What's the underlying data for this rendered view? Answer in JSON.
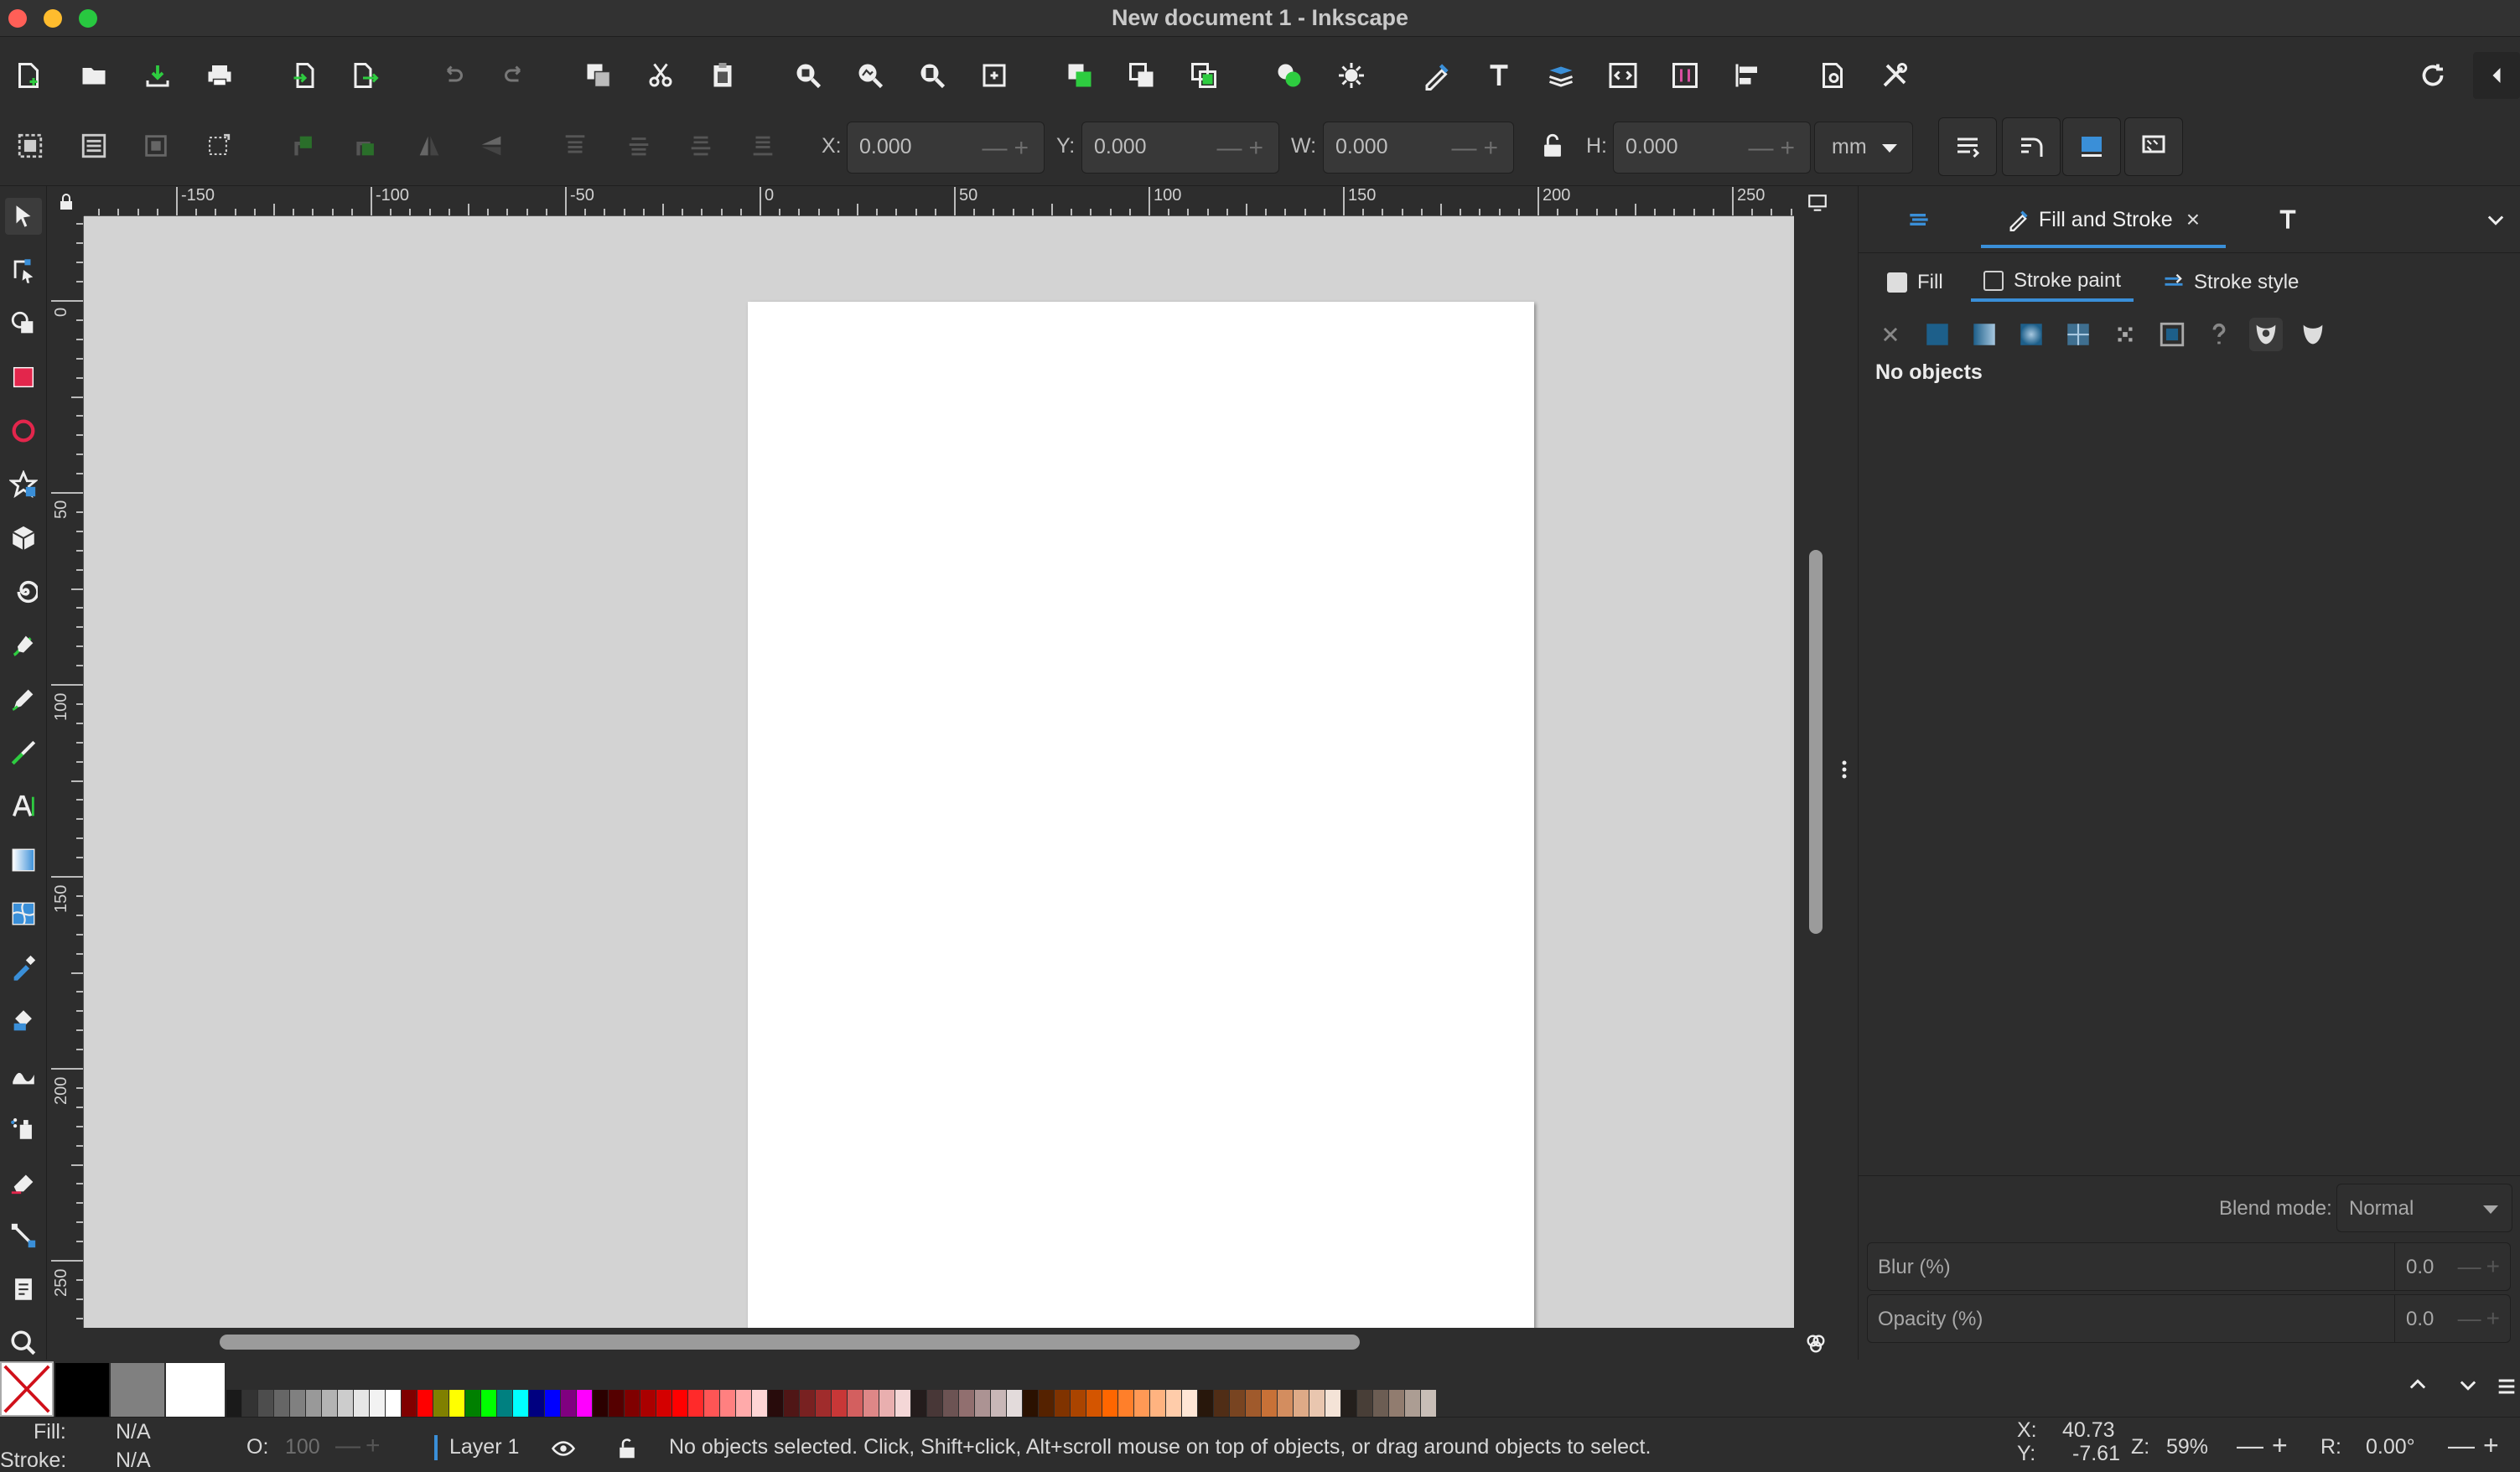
{
  "window": {
    "title": "New document 1 - Inkscape"
  },
  "controls": {
    "x_label": "X:",
    "x_value": "0.000",
    "y_label": "Y:",
    "y_value": "0.000",
    "w_label": "W:",
    "w_value": "0.000",
    "h_label": "H:",
    "h_value": "0.000",
    "unit": "mm"
  },
  "rulers": {
    "h_labels": [
      "-150",
      "-100",
      "-50",
      "0",
      "50",
      "100",
      "150",
      "200",
      "250"
    ],
    "v_labels": [
      "0",
      "50",
      "100",
      "150",
      "200",
      "250"
    ]
  },
  "dock": {
    "active_tab": "Fill and Stroke",
    "sub_tabs": [
      "Fill",
      "Stroke paint",
      "Stroke style"
    ],
    "message": "No objects",
    "blend_label": "Blend mode:",
    "blend_value": "Normal",
    "blur_label": "Blur (%)",
    "blur_value": "0.0",
    "opacity_label": "Opacity (%)",
    "opacity_value": "0.0"
  },
  "status": {
    "fill_label": "Fill:",
    "fill_value": "N/A",
    "stroke_label": "Stroke:",
    "stroke_value": "N/A",
    "opacity_label": "O:",
    "opacity_value": "100",
    "layer": "Layer 1",
    "message": "No objects selected. Click, Shift+click, Alt+scroll mouse on top of objects, or drag around objects to select.",
    "x_label": "X:",
    "x_value": "40.73",
    "y_label": "Y:",
    "y_value": "-7.61",
    "zoom_label": "Z:",
    "zoom_value": "59%",
    "rotation_label": "R:",
    "rotation_value": "0.00°"
  },
  "palette": {
    "colors": [
      "#000000",
      "#808080",
      "#ffffff",
      "#1a1a1a",
      "#333333",
      "#4d4d4d",
      "#666666",
      "#808080",
      "#999999",
      "#b3b3b3",
      "#cccccc",
      "#e6e6e6",
      "#f2f2f2",
      "#ffffff",
      "#800000",
      "#ff0000",
      "#808000",
      "#ffff00",
      "#008000",
      "#00ff00",
      "#008080",
      "#00ffff",
      "#000080",
      "#0000ff",
      "#800080",
      "#ff00ff",
      "#2b0000",
      "#550000",
      "#800000",
      "#aa0000",
      "#d40000",
      "#ff0000",
      "#ff2a2a",
      "#ff5555",
      "#ff8080",
      "#ffaaaa",
      "#ffd5d5",
      "#280b0b",
      "#501616",
      "#782121",
      "#a02c2c",
      "#c83737",
      "#d35f5f",
      "#de8787",
      "#e9afaf",
      "#f4d7d7",
      "#241c1c",
      "#483737",
      "#6c5353",
      "#916f6f",
      "#ac9393",
      "#c8b7b7",
      "#e3dbdb",
      "#2b1100",
      "#552200",
      "#803300",
      "#aa4400",
      "#d45500",
      "#ff6600",
      "#ff7f2a",
      "#ff9955",
      "#ffb380",
      "#ffccaa",
      "#ffe6d5",
      "#28170b",
      "#502d16",
      "#784421",
      "#a05a2c",
      "#c87137",
      "#d38d5f",
      "#deaa87",
      "#e9c6af",
      "#f4e3d7",
      "#241f1c",
      "#483e37",
      "#6c5d53",
      "#917c6f",
      "#ac9d93",
      "#c8beb7"
    ]
  },
  "icons": {
    "tools": [
      "selector-icon",
      "node-icon",
      "shape-builder-icon",
      "rectangle-icon",
      "ellipse-icon",
      "star-icon",
      "box3d-icon",
      "spiral-icon",
      "pen-icon",
      "pencil-icon",
      "calligraphy-icon",
      "text-icon",
      "gradient-icon",
      "mesh-icon",
      "dropper-icon",
      "paint-bucket-icon",
      "tweak-icon",
      "spray-icon",
      "eraser-icon",
      "connector-icon",
      "pages-icon",
      "zoom-icon"
    ]
  }
}
